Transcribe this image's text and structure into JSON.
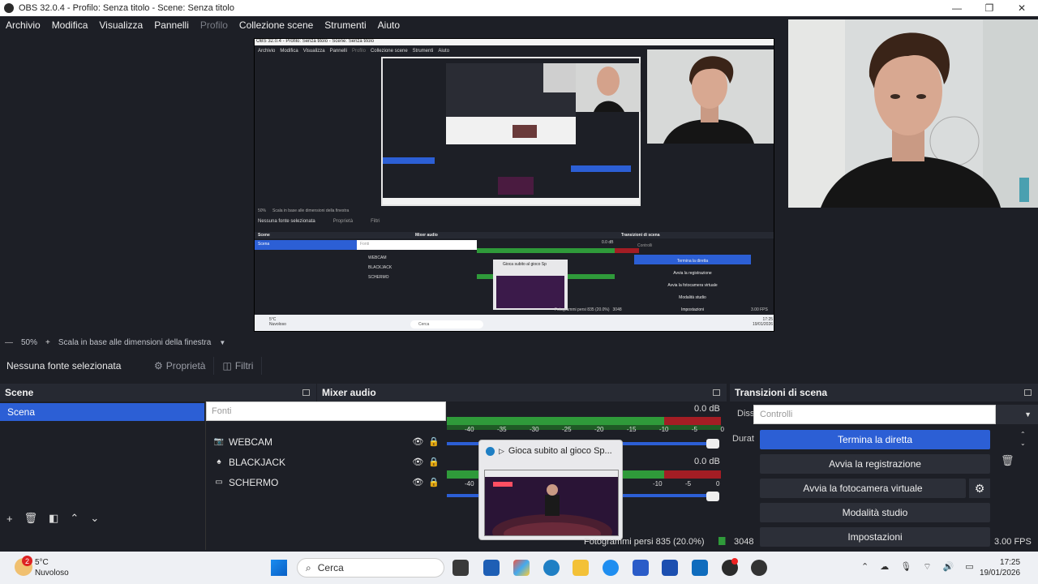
{
  "window": {
    "title": "OBS 32.0.4 - Profilo: Senza titolo - Scene: Senza titolo",
    "controls": [
      "—",
      "❐",
      "✕"
    ]
  },
  "menu": [
    "Archivio",
    "Modifica",
    "Visualizza",
    "Pannelli",
    "Profilo",
    "Collezione scene",
    "Strumenti",
    "Aiuto"
  ],
  "zoom": {
    "value": "50%",
    "minus": "—",
    "plus": "+",
    "mode": "Scala in base alle dimensioni della finestra"
  },
  "source_toolbar": {
    "no_selection": "Nessuna fonte selezionata",
    "properties": "Proprietà",
    "filters": "Filtri"
  },
  "scenes": {
    "title": "Scene",
    "items": [
      "Scena"
    ]
  },
  "sources": {
    "header_placeholder": "Fonti",
    "items": [
      {
        "name": "WEBCAM",
        "icon": "camera-icon"
      },
      {
        "name": "BLACKJACK",
        "icon": "game-capture-icon"
      },
      {
        "name": "SCHERMO",
        "icon": "monitor-icon"
      }
    ]
  },
  "audio_mixer": {
    "title": "Mixer audio",
    "channels": [
      {
        "db": "0.0 dB",
        "ticks": [
          "-40",
          "-35",
          "-30",
          "-25",
          "-20",
          "-15",
          "-10",
          "-5",
          "0"
        ]
      },
      {
        "db": "0.0 dB",
        "ticks": [
          "-40",
          "-10",
          "-5",
          "0"
        ]
      }
    ]
  },
  "tooltip_popup": {
    "title": "Gioca subito al gioco Sp..."
  },
  "transitions": {
    "title": "Transizioni di scena",
    "dissolve_label": "Diss",
    "duration_label": "Durat",
    "controls_placeholder": "Controlli",
    "buttons": [
      {
        "label": "Termina la diretta",
        "active": true
      },
      {
        "label": "Avvia la registrazione",
        "active": false
      },
      {
        "label": "Avvia la fotocamera virtuale",
        "active": false
      },
      {
        "label": "Modalità studio",
        "active": false
      },
      {
        "label": "Impostazioni",
        "active": false
      }
    ]
  },
  "status_bar": {
    "frames": "Fotogrammi persi 835 (20.0%)",
    "bitrate": "3048",
    "fps": "3.00 FPS"
  },
  "taskbar": {
    "weather_badge": "2",
    "temperature": "5°C",
    "condition": "Nuvoloso",
    "search_label": "Cerca",
    "time": "17:25",
    "date": "19/01/2026"
  },
  "nested_preview": {
    "title": "OBS 32.0.4 - Profilo: Senza titolo - Scene: Senza titolo",
    "menu": [
      "Archivio",
      "Modifica",
      "Visualizza",
      "Pannelli",
      "Profilo",
      "Collezione scene",
      "Strumenti",
      "Aiuto"
    ],
    "zoom": "50%",
    "mode": "Scala in base alle dimensioni della finestra",
    "no_selection": "Nessuna fonte selezionata",
    "properties": "Proprietà",
    "filters": "Filtri",
    "scenes_title": "Scene",
    "scene_item": "Scena",
    "sources_placeholder": "Fonti",
    "sources": [
      "WEBCAM",
      "BLACKJACK",
      "SCHERMO"
    ],
    "mixer_title": "Mixer audio",
    "db": "0.0 dB",
    "transitions_title": "Transizioni di scena",
    "controls_placeholder": "Controlli",
    "buttons": [
      "Termina la diretta",
      "Avvia la registrazione",
      "Avvia la fotocamera virtuale",
      "Modalità studio",
      "Impostazioni"
    ],
    "popup_title": "Gioca subito al gioco Sp",
    "frames": "Fotogrammi persi 835 (20.0%)",
    "bitrate": "3048",
    "fps": "3.00 FPS",
    "temperature": "5°C",
    "condition": "Nuvoloso",
    "search_label": "Cerca",
    "time": "17:25",
    "date": "19/01/2026"
  },
  "colors": {
    "background": "#1d1f26",
    "dock_header": "#262932",
    "accent": "#2c5fd5",
    "meter_green": "#2f9a3a",
    "meter_yellow": "#b9a425",
    "meter_red": "#a31d24"
  }
}
